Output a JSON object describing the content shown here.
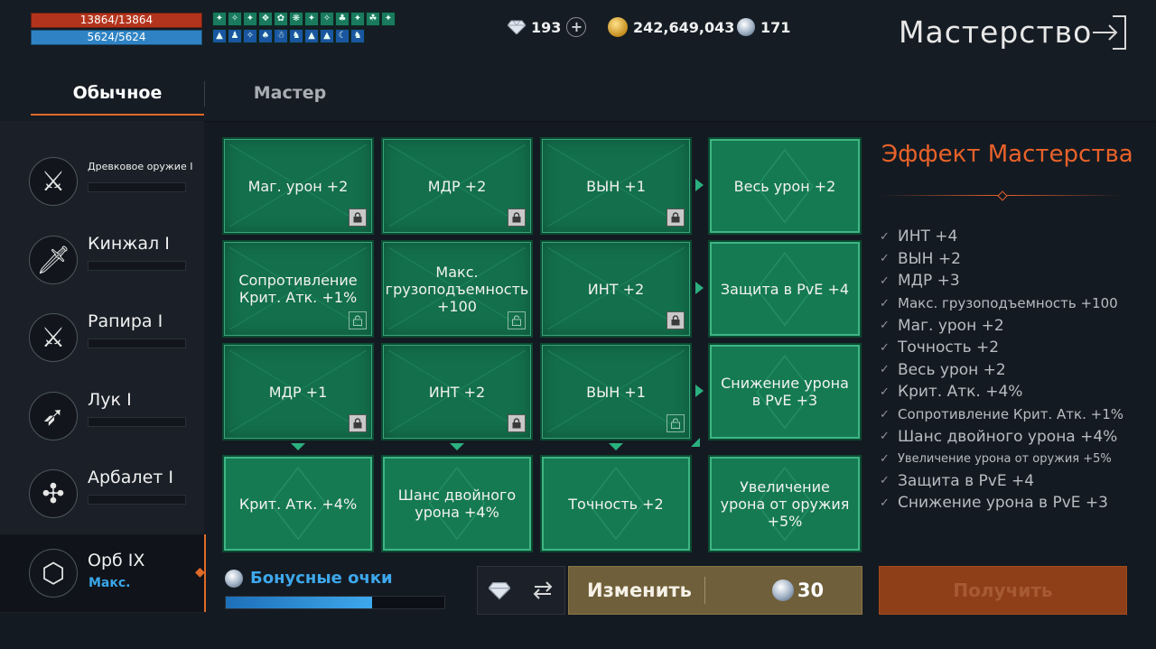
{
  "status": {
    "hp": "13864/13864",
    "mp": "5624/5624",
    "buffs_row1": [
      "✦",
      "✧",
      "✦",
      "❖",
      "✿",
      "❋",
      "✦",
      "✧",
      "♣",
      "✦",
      "☘",
      "✦"
    ],
    "buffs_row2": [
      "▲",
      "♟",
      "✧",
      "♠",
      "☃",
      "♞",
      "▲",
      "▲",
      "☾",
      "♞"
    ]
  },
  "currency": {
    "gems": "193",
    "gold": "242,649,043",
    "orbs": "171"
  },
  "title": "Мастерство",
  "tabs": {
    "normal": "Обычное",
    "master": "Мастер"
  },
  "weapons": [
    {
      "name": "Древковое оружие",
      "rank": "I",
      "icon": "polearm-icon"
    },
    {
      "name": "Кинжал",
      "rank": "I",
      "icon": "dagger-icon"
    },
    {
      "name": "Рапира",
      "rank": "I",
      "icon": "rapier-icon"
    },
    {
      "name": "Лук",
      "rank": "I",
      "icon": "bow-icon"
    },
    {
      "name": "Арбалет",
      "rank": "I",
      "icon": "crossbow-icon"
    },
    {
      "name": "Орб",
      "rank": "IX",
      "sub": "Макс.",
      "icon": "orb-icon",
      "selected": true
    }
  ],
  "grid": {
    "r1": [
      "Маг. урон  +2",
      "МДР  +2",
      "ВЫН  +1",
      "Весь урон  +2"
    ],
    "r2": [
      "Сопротивление Крит. Атк. +1%",
      "Макс. грузоподъемность +100",
      "ИНТ  +2",
      "Защита в PvE +4"
    ],
    "r3": [
      "МДР  +1",
      "ИНТ  +2",
      "ВЫН  +1",
      "Снижение урона в PvE +3"
    ],
    "r4": [
      "Крит. Атк. +4%",
      "Шанс двойного урона +4%",
      "Точность  +2",
      "Увеличение урона от оружия +5%"
    ]
  },
  "effect": {
    "title": "Эффект Мастерства",
    "items": [
      "ИНТ +4",
      "ВЫН +2",
      "МДР +3",
      "Макс. грузоподъемность +100",
      "Маг. урон +2",
      "Точность +2",
      "Весь урон +2",
      "Крит. Атк. +4%",
      "Сопротивление Крит. Атк. +1%",
      "Шанс двойного урона +4%",
      "Увеличение урона от оружия +5%",
      "Защита в PvE +4",
      "Снижение урона в PvE +3"
    ]
  },
  "bonus": {
    "label": "Бонусные очки",
    "progress": 0.67
  },
  "buttons": {
    "change": "Изменить",
    "change_cost": "30",
    "get": "Получить"
  },
  "colors": {
    "accent": "#e06a28",
    "tile": "#136f4c",
    "blue": "#3ea8ec"
  }
}
